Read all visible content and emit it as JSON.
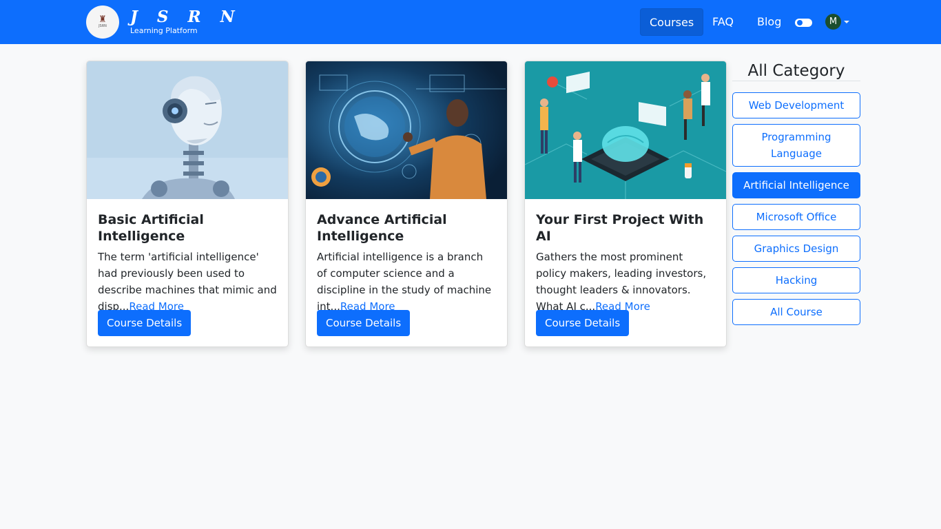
{
  "brand": {
    "title": "J S R N",
    "subtitle": "Learning Platform"
  },
  "nav": {
    "items": [
      {
        "label": "Courses",
        "active": true
      },
      {
        "label": "FAQ",
        "active": false
      },
      {
        "label": "Blog",
        "active": false
      }
    ],
    "avatar_initial": "M"
  },
  "courses": [
    {
      "title": "Basic Artificial Intelligence",
      "description": "The term 'artificial intelligence' had previously been used to describe machines that mimic and disp...",
      "read_more": "Read More",
      "button": "Course Details",
      "image": "robot-head-illustration"
    },
    {
      "title": "Advance Artificial Intelligence",
      "description": "Artificial intelligence is a branch of computer science and a discipline in the study of machine int...",
      "read_more": "Read More",
      "button": "Course Details",
      "image": "holographic-globe-illustration"
    },
    {
      "title": "Your First Project With AI",
      "description": "Gathers the most prominent policy makers, leading investors, thought leaders & innovators. What AI c...",
      "read_more": "Read More",
      "button": "Course Details",
      "image": "isometric-ai-brain-illustration"
    }
  ],
  "sidebar": {
    "title": "All Category",
    "categories": [
      {
        "label": "Web Development",
        "active": false
      },
      {
        "label": "Programming Language",
        "active": false
      },
      {
        "label": "Artificial Intelligence",
        "active": true
      },
      {
        "label": "Microsoft Office",
        "active": false
      },
      {
        "label": "Graphics Design",
        "active": false
      },
      {
        "label": "Hacking",
        "active": false
      },
      {
        "label": "All Course",
        "active": false
      }
    ]
  },
  "colors": {
    "primary": "#0d6efd",
    "navbar": "#0d6efd",
    "background": "#f8f9fa"
  }
}
